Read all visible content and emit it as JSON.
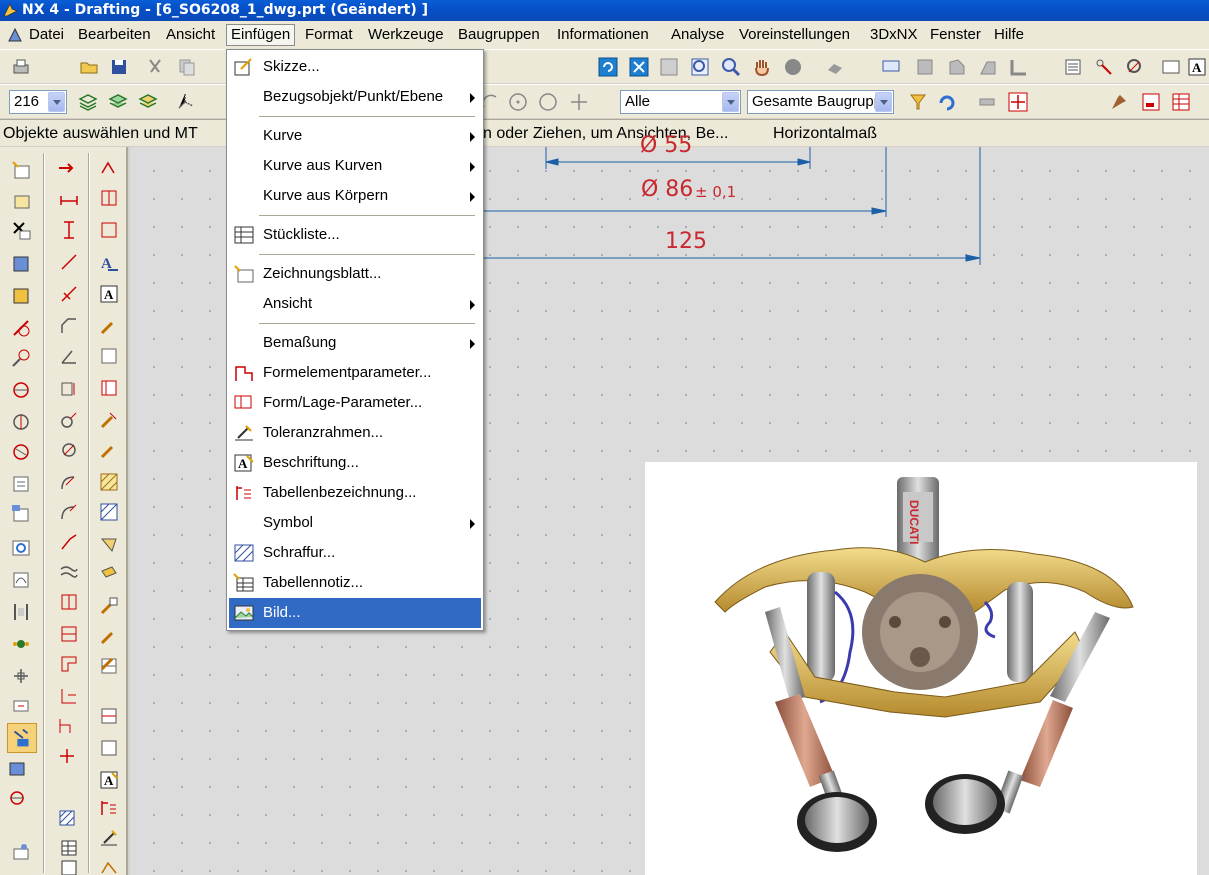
{
  "window": {
    "title": "NX 4 - Drafting - [6_SO6208_1_dwg.prt (Geändert) ]"
  },
  "menubar": {
    "items": [
      {
        "label": "Datei"
      },
      {
        "label": "Bearbeiten"
      },
      {
        "label": "Ansicht"
      },
      {
        "label": "Einfügen"
      },
      {
        "label": "Format"
      },
      {
        "label": "Werkzeuge"
      },
      {
        "label": "Baugruppen"
      },
      {
        "label": "Informationen"
      },
      {
        "label": "Analyse"
      },
      {
        "label": "Voreinstellungen"
      },
      {
        "label": "3DxNX"
      },
      {
        "label": "Fenster"
      },
      {
        "label": "Hilfe"
      }
    ],
    "active": "Einfügen"
  },
  "toolbar2": {
    "layer_value": "216",
    "filter_value": "Alle",
    "scope_value": "Gesamte Baugruppe"
  },
  "cue": {
    "prompt_left": "Objekte auswählen und MT",
    "prompt_mid": "n oder Ziehen, um Ansichten, Be...",
    "status_right": "Horizontalmaß"
  },
  "drawing": {
    "dim_top": "Ø 55",
    "dim_mid": "Ø 86",
    "dim_mid_tol": "± 0,1",
    "dim_bottom": "125",
    "image_logo": "DUCATI",
    "colors": {
      "dimension": "#c8282e",
      "leader": "#1b5fa8"
    }
  },
  "insert_menu": {
    "items": [
      {
        "label": "Skizze...",
        "icon": "sketch-icon",
        "submenu": false
      },
      {
        "label": "Bezugsobjekt/Punkt/Ebene",
        "icon": null,
        "submenu": true
      },
      {
        "label": "Kurve",
        "icon": null,
        "submenu": true
      },
      {
        "label": "Kurve aus Kurven",
        "icon": null,
        "submenu": true
      },
      {
        "label": "Kurve aus Körpern",
        "icon": null,
        "submenu": true
      },
      {
        "label": "Stückliste...",
        "icon": "parts-list-icon",
        "submenu": false
      },
      {
        "label": "Zeichnungsblatt...",
        "icon": "drawing-sheet-icon",
        "submenu": false
      },
      {
        "label": "Ansicht",
        "icon": null,
        "submenu": true
      },
      {
        "label": "Bemaßung",
        "icon": null,
        "submenu": true
      },
      {
        "label": "Formelementparameter...",
        "icon": "feature-parameters-icon",
        "submenu": false
      },
      {
        "label": "Form/Lage-Parameter...",
        "icon": "gdt-parameters-icon",
        "submenu": false
      },
      {
        "label": "Toleranzrahmen...",
        "icon": "feature-control-frame-icon",
        "submenu": false
      },
      {
        "label": "Beschriftung...",
        "icon": "annotation-icon",
        "submenu": false
      },
      {
        "label": "Tabellenbezeichnung...",
        "icon": "table-label-icon",
        "submenu": false
      },
      {
        "label": "Symbol",
        "icon": null,
        "submenu": true
      },
      {
        "label": "Schraffur...",
        "icon": "crosshatch-icon",
        "submenu": false
      },
      {
        "label": "Tabellennotiz...",
        "icon": "tabular-note-icon",
        "submenu": false
      },
      {
        "label": "Bild...",
        "icon": "image-icon",
        "submenu": false,
        "highlighted": true
      }
    ]
  }
}
